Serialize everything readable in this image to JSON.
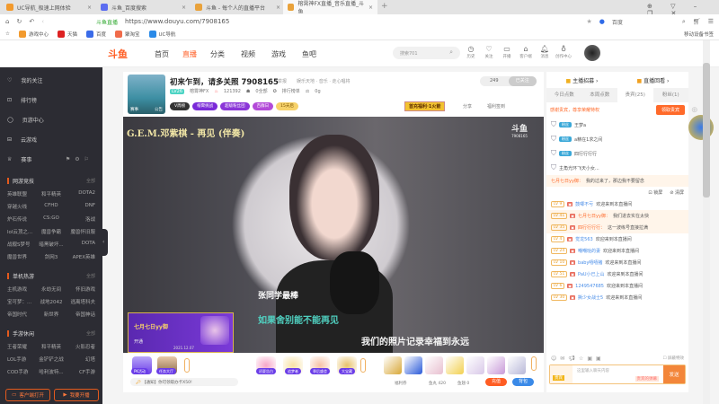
{
  "browser": {
    "tabs": [
      {
        "label": "UC导航_极速上网体验"
      },
      {
        "label": "斗鱼_百度搜索"
      },
      {
        "label": "斗鱼 - 每个人的直播平台"
      },
      {
        "label": "榕霄神FX直播_音乐直播_斗鱼"
      }
    ],
    "site_badge": "斗鱼直播",
    "url": "https://www.douyu.com/7908165",
    "search_engine": "百度",
    "bookmarks": [
      "游戏中心",
      "天猫",
      "百度",
      "聚淘宝",
      "UC导航"
    ],
    "mobile_bookmarks": "移动设备书签"
  },
  "header": {
    "logo": "斗鱼",
    "nav": [
      "首页",
      "直播",
      "分类",
      "视频",
      "游戏",
      "鱼吧"
    ],
    "search_placeholder": "搜索701",
    "icons": [
      {
        "label": "历史"
      },
      {
        "label": "关注"
      },
      {
        "label": "开播"
      },
      {
        "label": "客户端"
      },
      {
        "label": "消息"
      },
      {
        "label": "创作中心"
      }
    ]
  },
  "sidebar": {
    "items": [
      "我的关注",
      "排行榜",
      "页游中心",
      "云游戏",
      "赛事"
    ],
    "sections": [
      {
        "title": "网游竞技",
        "all": "全部",
        "games": [
          "英雄联盟",
          "和平精英",
          "DOTA2",
          "穿越火线",
          "CFHD",
          "DNF",
          "炉石传说",
          "CS:GO",
          "洛战",
          "lol云顶之...",
          "魔兽争霸",
          "魔兽怀旧服",
          "战舰S梦号",
          "暗黑破坏...",
          "DOTA",
          "魔兽世界",
          "剑网3",
          "APEX英雄"
        ]
      },
      {
        "title": "单机热游",
        "all": "全部",
        "games": [
          "主机游戏",
          "永劫无间",
          "怀旧游戏",
          "宝可梦：...",
          "战地2042",
          "逃离塔科夫",
          "帝国时代",
          "新世界",
          "帝国神话"
        ]
      },
      {
        "title": "手游休闲",
        "all": "全部",
        "games": [
          "王者荣耀",
          "和平精英",
          "火影忍者",
          "LOL手游",
          "金铲铲之战",
          "幻塔",
          "COD手游",
          "哈利波特...",
          "CF手游"
        ]
      }
    ],
    "client_btn": "客户端打开",
    "start_btn": "我要开播"
  },
  "room": {
    "title": "初来乍到，请多关照 7908165",
    "report": "举报",
    "category": "娱乐天地 · 音乐 · 走心唱将",
    "level": "LV26",
    "anchor": "榕霄神FX",
    "heat": "121392",
    "followers": "0全部",
    "rank": "排行榜单",
    "fans": "0g",
    "badges": [
      "V周榜",
      "榕霄挑战",
      "超级粉丝团",
      "百群日",
      "15天后"
    ],
    "follow_count": "249",
    "follow_btn": "已关注",
    "promo": "首充福利·1火箭",
    "share": "分享",
    "welfare": "福利签到",
    "avatar_tags": [
      "赛事",
      "公告"
    ]
  },
  "video": {
    "song": "G.E.M.邓紫棋 - 再见 (伴奏)",
    "watermark_id": "7908165",
    "overlay": "张同学最棒",
    "lyric1": "如果舍别能不能再见",
    "lyric2": "我们的照片记录幸福到永远",
    "card_name": "七月七日yy御",
    "card_sub": "开通",
    "card_date": "2021.12.07"
  },
  "gifts": {
    "left": [
      {
        "label": "PK活动"
      },
      {
        "label": "任务大厅"
      }
    ],
    "mid": [
      {
        "label": "初夏告白"
      },
      {
        "label": "追梦者"
      },
      {
        "label": "季后盛会"
      },
      {
        "label": "大宝藏"
      }
    ],
    "notice": "【通知】你可领取办卡X50!",
    "welfare": "福利券",
    "fish_balls": "鱼丸 420",
    "fish_fins": "鱼翅 0",
    "recharge": "充值",
    "backpack": "背包"
  },
  "chat": {
    "top": [
      "主播招募",
      "直播回看"
    ],
    "tabs": [
      "今日点数",
      "本周点数",
      "贵宾(25)",
      "粉丝(1)"
    ],
    "join_text": "感谢贵宾，尊享荣耀特权",
    "join_btn": "领取贵宾",
    "vips": [
      "王梦a",
      "a精在1求之间",
      "四行行行行",
      "主角光环飞天小女..."
    ],
    "messages": [
      {
        "name": "七月七日yy御：",
        "text": "我的过来了，那边我不要留念"
      },
      {
        "lv": "LV 9",
        "name": "鼓唧不亏",
        "text": "欢迎来到本直播间"
      },
      {
        "lv": "LV 41",
        "name": "七月七日yy御：",
        "text": "我们进去实在太快"
      },
      {
        "lv": "LV 35",
        "name": "四行行行行：",
        "text": "这一波练号直接拉满"
      },
      {
        "lv": "LV 4",
        "name": "觉龙563",
        "text": "欢迎来到本直播间"
      },
      {
        "lv": "LV 24",
        "name": "嘲嘲哒的妻",
        "text": "欢迎来到本直播间"
      },
      {
        "lv": "LV 10",
        "name": "baby嘻嘻猪",
        "text": "欢迎来到本直播间"
      },
      {
        "lv": "LV 51",
        "name": "PaU小已上山",
        "text": "欢迎来到本直播间"
      },
      {
        "lv": "LV 6",
        "name": "1249547685",
        "text": "欢迎来到本直播间"
      },
      {
        "lv": "LV 30",
        "name": "撕少女战士5",
        "text": "欢迎来到本直播间"
      }
    ],
    "lock": "锁屏",
    "clear": "清屏",
    "hide_effects": "屏蔽特效",
    "input_placeholder": "这里输入聊天内容",
    "send": "发送",
    "vip_send": "贵宾的弹幕"
  },
  "colors": {
    "accent": "#ff5d23",
    "sidebar": "#2c2c33"
  }
}
